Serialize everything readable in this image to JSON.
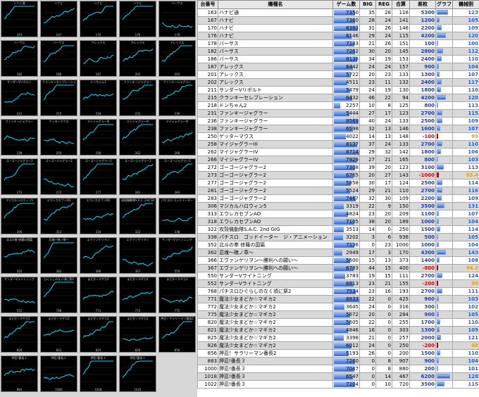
{
  "table": {
    "headers": [
      "台番号",
      "機種名",
      "ゲーム数",
      "BIG",
      "REG",
      "合算",
      "差枚",
      "グラフ",
      "機械割"
    ],
    "rows": [
      {
        "no": "163",
        "name": "ハナビ通",
        "games": "7350",
        "big": "35",
        "reg": "28",
        "total": "116",
        "diff": "5300",
        "rate": "123"
      },
      {
        "no": "167",
        "name": "ハナビ",
        "games": "7360",
        "big": "28",
        "reg": "24",
        "total": "141",
        "diff": "1200",
        "rate": "105"
      },
      {
        "no": "170",
        "name": "ハナビ",
        "games": "8363",
        "big": "31",
        "reg": "26",
        "total": "146",
        "diff": "2200",
        "rate": "109"
      },
      {
        "no": "176",
        "name": "ハナビ",
        "games": "6146",
        "big": "29",
        "reg": "24",
        "total": "115",
        "diff": "4200",
        "rate": "120"
      },
      {
        "no": "178",
        "name": "バーサス",
        "games": "7143",
        "big": "21",
        "reg": "26",
        "total": "151",
        "diff": "100",
        "rate": "100"
      },
      {
        "no": "182",
        "name": "バーサス",
        "games": "7262",
        "big": "30",
        "reg": "20",
        "total": "145",
        "diff": "2800",
        "rate": "112"
      },
      {
        "no": "186",
        "name": "バーサス",
        "games": "8138",
        "big": "34",
        "reg": "19",
        "total": "153",
        "diff": "2400",
        "rate": "110"
      },
      {
        "no": "187",
        "name": "アレックス",
        "games": "6442",
        "big": "24",
        "reg": "24",
        "total": "157",
        "diff": "900",
        "rate": "104"
      },
      {
        "no": "201",
        "name": "アレックス",
        "games": "5722",
        "big": "20",
        "reg": "23",
        "total": "133",
        "diff": "1300",
        "rate": "107"
      },
      {
        "no": "202",
        "name": "アレックス",
        "games": "4511",
        "big": "23",
        "reg": "11",
        "total": "132",
        "diff": "2400",
        "rate": "117"
      },
      {
        "no": "211",
        "name": "サンダーVリボルト",
        "games": "5479",
        "big": "24",
        "reg": "19",
        "total": "130",
        "diff": "1800",
        "rate": "110"
      },
      {
        "no": "215",
        "name": "クランキーセレブレーション",
        "games": "6432",
        "big": "46",
        "reg": "22",
        "total": "94",
        "diff": "4200",
        "rate": "120"
      },
      {
        "no": "218",
        "name": "ドンちゃん2",
        "games": "2257",
        "big": "10",
        "reg": "8",
        "total": "125",
        "diff": "800",
        "rate": "113"
      },
      {
        "no": "231",
        "name": "ファンキージャグラー",
        "games": "5444",
        "big": "27",
        "reg": "17",
        "total": "123",
        "diff": "2700",
        "rate": "115"
      },
      {
        "no": "236",
        "name": "ファンキージャグラー",
        "games": "8569",
        "big": "40",
        "reg": "24",
        "total": "133",
        "diff": "2500",
        "rate": "109"
      },
      {
        "no": "238",
        "name": "ファンキージャグラー",
        "games": "6598",
        "big": "32",
        "reg": "13",
        "total": "146",
        "diff": "1600",
        "rate": "107"
      },
      {
        "no": "250",
        "name": "ゲッターマウス",
        "games": "4022",
        "big": "14",
        "reg": "13",
        "total": "148",
        "diff": "-100",
        "rate": "99"
      },
      {
        "no": "258",
        "name": "マイジャグラーIII",
        "games": "8137",
        "big": "37",
        "reg": "24",
        "total": "133",
        "diff": "2700",
        "rate": "110"
      },
      {
        "no": "262",
        "name": "マイジャグラーIV",
        "games": "8714",
        "big": "29",
        "reg": "32",
        "total": "142",
        "diff": "1800",
        "rate": "106"
      },
      {
        "no": "266",
        "name": "マイジャグラーIV",
        "games": "7929",
        "big": "27",
        "reg": "21",
        "total": "165",
        "diff": "800",
        "rate": "103"
      },
      {
        "no": "272",
        "name": "ゴーゴージャグラー2",
        "games": "7308",
        "big": "39",
        "reg": "20",
        "total": "123",
        "diff": "3100",
        "rate": "113"
      },
      {
        "no": "273",
        "name": "ゴーゴージャグラー2",
        "games": "6765",
        "big": "20",
        "reg": "27",
        "total": "143",
        "diff": "-1000",
        "rate": "95.4"
      },
      {
        "no": "277",
        "name": "ゴーゴージャグラー2",
        "games": "5858",
        "big": "30",
        "reg": "17",
        "total": "124",
        "diff": "2500",
        "rate": "114"
      },
      {
        "no": "281",
        "name": "ゴーゴージャグラー2",
        "games": "5524",
        "big": "29",
        "reg": "21",
        "total": "110",
        "diff": "2700",
        "rate": "116"
      },
      {
        "no": "283",
        "name": "ゴーゴージャグラー2",
        "games": "7467",
        "big": "32",
        "reg": "30",
        "total": "109",
        "diff": "2200",
        "rate": "109"
      },
      {
        "no": "306",
        "name": "マジカルハロウィン5",
        "games": "3319",
        "big": "22",
        "reg": "9",
        "total": "150",
        "diff": "3500",
        "rate": "131"
      },
      {
        "no": "313",
        "name": "エウレカセブンAO",
        "games": "4824",
        "big": "23",
        "reg": "20",
        "total": "209",
        "diff": "1100",
        "rate": "107"
      },
      {
        "no": "318",
        "name": "エウレカセブンAO",
        "games": "7105",
        "big": "38",
        "reg": "20",
        "total": "189",
        "diff": "1000",
        "rate": "104"
      },
      {
        "no": "322",
        "name": "攻殻機動隊S.A.C. 2nd GIG",
        "games": "3513",
        "big": "14",
        "reg": "0",
        "total": "250",
        "diff": "1500",
        "rate": "114"
      },
      {
        "no": "338",
        "name": "パチスロ　ゴッドイーター　ジ・アニメーション",
        "games": "3202",
        "big": "3",
        "reg": "6",
        "total": "936",
        "diff": "500",
        "rate": "105"
      },
      {
        "no": "352",
        "name": "北斗の拳 修羅の国篇",
        "games": "7136",
        "big": "0",
        "reg": "23",
        "total": "1000",
        "diff": "1000",
        "rate": "104"
      },
      {
        "no": "362",
        "name": "忍魂～暁ノ章～",
        "games": "2949",
        "big": "17",
        "reg": "3",
        "total": "170",
        "diff": "4300",
        "rate": "143"
      },
      {
        "no": "366",
        "name": "エヴァンゲリヲン～勝利への願い～",
        "games": "5600",
        "big": "15",
        "reg": "13",
        "total": "373",
        "diff": "1400",
        "rate": "108"
      },
      {
        "no": "367",
        "name": "エヴァンゲリヲン～勝利への願い～",
        "games": "6783",
        "big": "44",
        "reg": "15",
        "total": "400",
        "diff": "-800",
        "rate": "96.2"
      },
      {
        "no": "550",
        "name": "サンダーVライトニング",
        "games": "3783",
        "big": "19",
        "reg": "15",
        "total": "111",
        "diff": "2700",
        "rate": "124"
      },
      {
        "no": "552",
        "name": "サンダーVライトニング",
        "games": "6813",
        "big": "23",
        "reg": "21",
        "total": "155",
        "diff": "-200",
        "rate": "98"
      },
      {
        "no": "768",
        "name": "パチスロひぐらしのなく頃に祭2",
        "games": "7534",
        "big": "23",
        "reg": "16",
        "total": "193",
        "diff": "2700",
        "rate": "111"
      },
      {
        "no": "771",
        "name": "魔法少女まどか☆マギカ2",
        "games": "8833",
        "big": "22",
        "reg": "0",
        "total": "425",
        "diff": "900",
        "rate": "103"
      },
      {
        "no": "772",
        "name": "魔法少女まどか☆マギカ2",
        "games": "3645",
        "big": "24",
        "reg": "0",
        "total": "316",
        "diff": "300",
        "rate": "102"
      },
      {
        "no": "775",
        "name": "魔法少女まどか☆マギカ2",
        "games": "5672",
        "big": "20",
        "reg": "0",
        "total": "284",
        "diff": "900",
        "rate": "105"
      },
      {
        "no": "820",
        "name": "魔法少女まどか☆マギカ2",
        "games": "5605",
        "big": "22",
        "reg": "0",
        "total": "255",
        "diff": "1700",
        "rate": "110"
      },
      {
        "no": "821",
        "name": "魔法少女まどか☆マギカ2",
        "games": "4846",
        "big": "16",
        "reg": "0",
        "total": "303",
        "diff": "1300",
        "rate": "109"
      },
      {
        "no": "825",
        "name": "魔法少女まどか☆マギカ2",
        "games": "3398",
        "big": "21",
        "reg": "0",
        "total": "257",
        "diff": "2000",
        "rate": "121"
      },
      {
        "no": "826",
        "name": "魔法少女まどか☆マギカ2",
        "games": "6012",
        "big": "24",
        "reg": "0",
        "total": "250",
        "diff": "-200",
        "rate": "98"
      },
      {
        "no": "856",
        "name": "押忍！サラリーマン番長2",
        "games": "5193",
        "big": "26",
        "reg": "0",
        "total": "200",
        "diff": "1500",
        "rate": "110"
      },
      {
        "no": "883",
        "name": "押忍!番長３",
        "games": "7260",
        "big": "0",
        "reg": "8",
        "total": "907",
        "diff": "900",
        "rate": "104"
      },
      {
        "no": "1000",
        "name": "押忍!番長３",
        "games": "7047",
        "big": "0",
        "reg": "8",
        "total": "880",
        "diff": "200",
        "rate": "101"
      },
      {
        "no": "1018",
        "name": "押忍!番長３",
        "games": "6547",
        "big": "0",
        "reg": "14",
        "total": "467",
        "diff": "6200",
        "rate": "128"
      },
      {
        "no": "1022",
        "name": "押忍!番長３",
        "games": "7204",
        "big": "0",
        "reg": "10",
        "total": "720",
        "diff": "3500",
        "rate": "115"
      }
    ]
  },
  "thumbnails": [
    {
      "title": "ハナビ通",
      "no": "163"
    },
    {
      "title": "ハナビ",
      "no": "167"
    },
    {
      "title": "ハナビ",
      "no": "170"
    },
    {
      "title": "ハナビ",
      "no": "176"
    },
    {
      "title": "バーサス",
      "no": "178"
    },
    {
      "title": "バーサス",
      "no": "182"
    },
    {
      "title": "バーサス",
      "no": "186"
    },
    {
      "title": "アレックス",
      "no": "187"
    },
    {
      "title": "アレックス",
      "no": "201"
    },
    {
      "title": "アレックス",
      "no": "202"
    },
    {
      "title": "サンダーVリボルト",
      "no": "211"
    },
    {
      "title": "クランキーセレブレーション",
      "no": "215"
    },
    {
      "title": "ドンちゃん2",
      "no": "218"
    },
    {
      "title": "ファンキージャグラー",
      "no": "231"
    },
    {
      "title": "ファンキージャグラー",
      "no": "236"
    },
    {
      "title": "ファンキージャグラー",
      "no": "238"
    },
    {
      "title": "ゲッターマウス",
      "no": "250"
    },
    {
      "title": "マイジャグラーIII",
      "no": "258"
    },
    {
      "title": "マイジャグラーIV",
      "no": "262"
    },
    {
      "title": "マイジャグラーIV",
      "no": "266"
    },
    {
      "title": "ゴーゴージャグラー2",
      "no": "272"
    },
    {
      "title": "ゴーゴージャグラー2",
      "no": "273"
    },
    {
      "title": "ゴーゴージャグラー2",
      "no": "277"
    },
    {
      "title": "ゴーゴージャグラー2",
      "no": "281"
    },
    {
      "title": "ゴーゴージャグラー2",
      "no": "283"
    },
    {
      "title": "マジカルハロウィン5",
      "no": "306"
    },
    {
      "title": "エウレカセブンAO",
      "no": "313"
    },
    {
      "title": "エウレカセブンAO",
      "no": "318"
    },
    {
      "title": "攻殻機動隊S.A.C. 2nd GIG",
      "no": "322"
    },
    {
      "title": "パチスロ ゴッドイーター",
      "no": "338"
    },
    {
      "title": "北斗の拳 修羅の国篇",
      "no": "352"
    },
    {
      "title": "忍魂～暁ノ章～",
      "no": "362"
    },
    {
      "title": "エヴァンゲリヲン",
      "no": "366"
    },
    {
      "title": "エヴァンゲリヲン",
      "no": "367"
    },
    {
      "title": "サンダーVライトニング",
      "no": "550"
    },
    {
      "title": "サンダーVライトニング",
      "no": "552"
    },
    {
      "title": "ひぐらしのなく頃に祭2",
      "no": "768"
    },
    {
      "title": "まどか☆マギカ2",
      "no": "771"
    },
    {
      "title": "まどか☆マギカ2",
      "no": "772"
    },
    {
      "title": "まどか☆マギカ2",
      "no": "775"
    },
    {
      "title": "まどか☆マギカ2",
      "no": "820"
    },
    {
      "title": "まどか☆マギカ2",
      "no": "821"
    },
    {
      "title": "まどか☆マギカ2",
      "no": "825"
    },
    {
      "title": "まどか☆マギカ2",
      "no": "826"
    },
    {
      "title": "押忍！サラリーマン番長2",
      "no": "856"
    },
    {
      "title": "押忍!番長３",
      "no": "883"
    },
    {
      "title": "押忍!番長３",
      "no": "1000"
    },
    {
      "title": "押忍!番長３",
      "no": "1018"
    },
    {
      "title": "押忍!番長３",
      "no": "1022"
    }
  ],
  "colors": {
    "positive": "#1a3fa8",
    "negative": "#e00000",
    "rate_high": "#1d5fd8",
    "rate_low": "#e6a100",
    "graph_line": "#00e0ff"
  }
}
